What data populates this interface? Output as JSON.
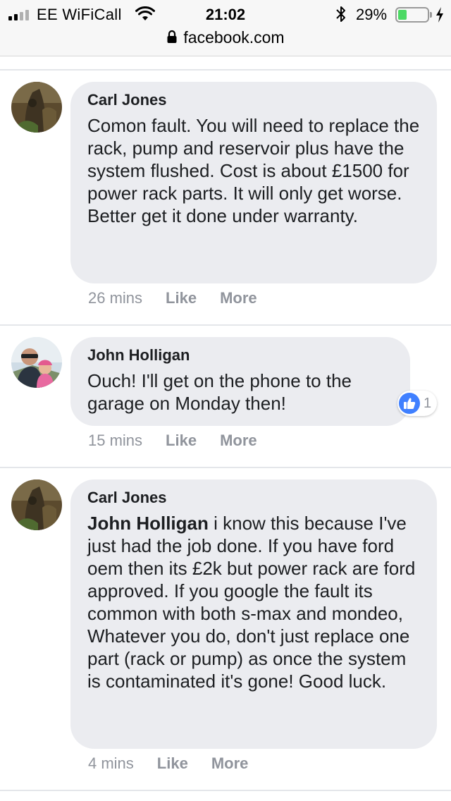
{
  "status_bar": {
    "carrier": "EE WiFiCall",
    "time": "21:02",
    "battery_percent": "29%",
    "battery_level": 0.29,
    "icons": [
      "signal-icon",
      "wifi-icon",
      "bluetooth-icon",
      "battery-icon",
      "charging-bolt-icon"
    ]
  },
  "address_bar": {
    "url": "facebook.com",
    "icon": "lock-icon"
  },
  "comments": [
    {
      "author": "Carl Jones",
      "mention": "",
      "text": "Comon fault. You will need to replace the rack, pump and reservoir plus have the system flushed. Cost is about £1500 for power rack parts. It will only get worse. Better get it done under warranty.",
      "time": "26 mins",
      "like_label": "Like",
      "more_label": "More"
    },
    {
      "author": "John Holligan",
      "mention": "",
      "text": "Ouch! I'll get on the phone to the garage on Monday then!",
      "time": "15 mins",
      "like_label": "Like",
      "more_label": "More",
      "reaction_count": "1",
      "reaction_icon": "thumbs-up-icon"
    },
    {
      "author": "Carl Jones",
      "mention": "John Holligan",
      "text": " i know this because I've just had the job done. If you have ford oem then its £2k but power rack are ford approved. If you google the fault its common with both s-max and mondeo, Whatever you do, don't just replace one part (rack or pump) as once the system is contaminated it's gone! Good luck.",
      "time": "4 mins",
      "like_label": "Like",
      "more_label": "More"
    }
  ],
  "colors": {
    "bubble": "#ebecf0",
    "meta_text": "#90949c",
    "like_blue": "#4080ff",
    "battery_green": "#4cd964"
  }
}
